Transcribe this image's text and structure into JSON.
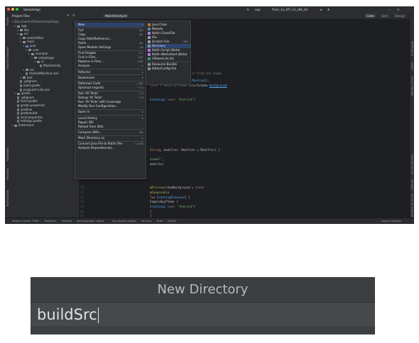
{
  "app": {
    "title": "SampleApp",
    "breadcrumb_project": "~/Documents/GitHub/SampleApp"
  },
  "toolbar": {
    "project_view_label": "Project Files",
    "run_config": "app",
    "device": "Pixel_3a_API_33_x86_64",
    "open_tab": "MainActivity.kt"
  },
  "editor_modes": {
    "code": "Code",
    "split": "Split",
    "design": "Design"
  },
  "left_tools": [
    "Project",
    "Resource Manager",
    "Bookmarks",
    "Structure",
    "Build Variants"
  ],
  "right_tools": [
    "Notifications",
    "Gradle",
    "Device Manager",
    "Running Devices",
    "Emulator",
    "Device File Explorer"
  ],
  "tree": [
    {
      "label": "app",
      "depth": 1,
      "kind": "folder"
    },
    {
      "label": "libs",
      "depth": 2,
      "kind": "folder"
    },
    {
      "label": "src",
      "depth": 2,
      "kind": "folder"
    },
    {
      "label": "androidTest",
      "depth": 3,
      "kind": "folder"
    },
    {
      "label": "main",
      "depth": 3,
      "kind": "folder"
    },
    {
      "label": "java",
      "depth": 4,
      "kind": "folder-blue"
    },
    {
      "label": "com",
      "depth": 5,
      "kind": "folder"
    },
    {
      "label": "example",
      "depth": 6,
      "kind": "folder"
    },
    {
      "label": "sampleapp",
      "depth": 7,
      "kind": "folder"
    },
    {
      "label": "ui",
      "depth": 8,
      "kind": "folder"
    },
    {
      "label": "MainActivity",
      "depth": 9,
      "kind": "file"
    },
    {
      "label": "res",
      "depth": 4,
      "kind": "folder"
    },
    {
      "label": "AndroidManifest.xml",
      "depth": 4,
      "kind": "file"
    },
    {
      "label": "test",
      "depth": 3,
      "kind": "folder"
    },
    {
      "label": ".gitignore",
      "depth": 2,
      "kind": "file"
    },
    {
      "label": "build.gradle",
      "depth": 2,
      "kind": "file"
    },
    {
      "label": "proguard-rules.pro",
      "depth": 2,
      "kind": "file"
    },
    {
      "label": "gradle",
      "depth": 1,
      "kind": "folder"
    },
    {
      "label": ".gitignore",
      "depth": 1,
      "kind": "file"
    },
    {
      "label": "build.gradle",
      "depth": 1,
      "kind": "file"
    },
    {
      "label": "gradle.properties",
      "depth": 1,
      "kind": "file"
    },
    {
      "label": "gradlew",
      "depth": 1,
      "kind": "file"
    },
    {
      "label": "gradlew.bat",
      "depth": 1,
      "kind": "file"
    },
    {
      "label": "local.properties",
      "depth": 1,
      "kind": "file"
    },
    {
      "label": "settings.gradle",
      "depth": 1,
      "kind": "file"
    },
    {
      "label": "Extensions",
      "depth": 0,
      "kind": "folder"
    }
  ],
  "context_menu": [
    {
      "label": "New",
      "shortcut": "",
      "submenu": true,
      "selected": true
    },
    {
      "sep": true
    },
    {
      "label": "Cut",
      "shortcut": "⌘X"
    },
    {
      "label": "Copy",
      "shortcut": "⌘C"
    },
    {
      "label": "Copy Path/Reference...",
      "shortcut": ""
    },
    {
      "label": "Paste",
      "shortcut": "⌘V"
    },
    {
      "label": "Open Module Settings",
      "shortcut": "↓⌘"
    },
    {
      "sep": true
    },
    {
      "label": "Find Usages",
      "shortcut": "⌥F7"
    },
    {
      "label": "Find in Files...",
      "shortcut": "⇧⌘F"
    },
    {
      "label": "Replace in Files...",
      "shortcut": "⇧⌘R"
    },
    {
      "label": "Analyze",
      "shortcut": "",
      "submenu": true
    },
    {
      "sep": true
    },
    {
      "label": "Refactor",
      "shortcut": "",
      "submenu": true
    },
    {
      "sep": true
    },
    {
      "label": "Bookmarks",
      "shortcut": "",
      "submenu": true
    },
    {
      "sep": true
    },
    {
      "label": "Reformat Code",
      "shortcut": "⌥⌘L"
    },
    {
      "label": "Optimize Imports",
      "shortcut": "^⌥O"
    },
    {
      "sep": true
    },
    {
      "label": "Run 'All Tests'",
      "shortcut": "^⇧R"
    },
    {
      "label": "Debug 'All Tests'",
      "shortcut": "^⇧D"
    },
    {
      "label": "Run 'All Tests' with Coverage",
      "shortcut": ""
    },
    {
      "label": "Modify Run Configuration...",
      "shortcut": ""
    },
    {
      "sep": true
    },
    {
      "label": "Open In",
      "shortcut": "",
      "submenu": true
    },
    {
      "sep": true
    },
    {
      "label": "Local History",
      "shortcut": "",
      "submenu": true
    },
    {
      "label": "Repair IDE",
      "shortcut": ""
    },
    {
      "label": "Reload from Disk",
      "shortcut": ""
    },
    {
      "sep": true
    },
    {
      "label": "Compare With...",
      "shortcut": "⌘D"
    },
    {
      "sep": true
    },
    {
      "label": "Mark Directory as",
      "shortcut": "",
      "submenu": true
    },
    {
      "sep": true
    },
    {
      "label": "Convert Java File to Kotlin File",
      "shortcut": "⌥⇧⌘K"
    },
    {
      "label": "Analyze Dependencies...",
      "shortcut": ""
    }
  ],
  "new_submenu": [
    {
      "label": "Java Class",
      "icon": "#c57825",
      "shortcut": ""
    },
    {
      "label": "Module",
      "icon": "#6f7ea7",
      "shortcut": ""
    },
    {
      "label": "Kotlin Class/File",
      "icon": "#b27be0",
      "shortcut": ""
    },
    {
      "label": "File",
      "icon": "#9aa0a8",
      "shortcut": ""
    },
    {
      "label": "Scratch File",
      "icon": "#9aa0a8",
      "shortcut": "⇧⌘N"
    },
    {
      "label": "Directory",
      "icon": "#8a8f98",
      "shortcut": "",
      "selected": true
    },
    {
      "label": "Kotlin Script (Beta)",
      "icon": "#b27be0",
      "shortcut": ""
    },
    {
      "label": "Kotlin Worksheet (Beta)",
      "icon": "#b27be0",
      "shortcut": ""
    },
    {
      "label": "CMakeLists.txt",
      "icon": "#3c9d6b",
      "shortcut": ""
    },
    {
      "sep": true
    },
    {
      "label": "Resource Bundle",
      "icon": "#8a8f98",
      "shortcut": ""
    },
    {
      "label": "EditorConfig File",
      "icon": "#8a8f98",
      "shortcut": ""
    }
  ],
  "code_lines": [
    {
      "parts": [
        [
          "",
          "te: Bundle?) {"
        ]
      ],
      "row": 15
    },
    {
      "parts": [
        [
          "cm",
          "ing the `background` color from the theme"
        ]
      ],
      "row": 21
    },
    {
      "parts": [
        [
          "",
          "modifier = Modifier."
        ],
        [
          "fn",
          "fillMaxSize"
        ],
        [
          "",
          "(),"
        ]
      ],
      "row": 24
    },
    {
      "parts": [
        [
          "",
          "color = MaterialTheme.colorScheme."
        ],
        [
          "pm",
          "background"
        ]
      ],
      "row": 26
    },
    {
      "parts": [
        [
          "fn",
          "Greeting"
        ],
        [
          "",
          "( "
        ],
        [
          "cm",
          "name: "
        ],
        [
          "st",
          "\"Android\""
        ],
        [
          "",
          ")"
        ]
      ],
      "row": 32
    },
    {
      "parts": [
        [
          "kw",
          "String"
        ],
        [
          "",
          ", modifier: Modifier = Modifier) {"
        ]
      ],
      "row": 53
    },
    {
      "parts": [
        [
          "",
          "  "
        ],
        [
          "st",
          "$name"
        ],
        [
          "",
          "!\","
        ]
      ],
      "row": 57
    },
    {
      "parts": [
        [
          "",
          "modifier"
        ]
      ],
      "row": 59
    },
    {
      "parts": [
        [
          "an",
          "@Preview"
        ],
        [
          "",
          "(showBackground = "
        ],
        [
          "kw",
          "true"
        ],
        [
          "",
          ")"
        ]
      ],
      "row": 69
    },
    {
      "parts": [
        [
          "an",
          "@Composable"
        ]
      ],
      "row": 71
    },
    {
      "parts": [
        [
          "kw",
          "fun "
        ],
        [
          "fn",
          "GreetingPreview"
        ],
        [
          "",
          "() {"
        ]
      ],
      "row": 73
    },
    {
      "parts": [
        [
          "",
          "    SampleAppTheme {"
        ]
      ],
      "row": 75
    },
    {
      "parts": [
        [
          "",
          "        "
        ],
        [
          "fn",
          "Greeting"
        ],
        [
          "",
          "( "
        ],
        [
          "cm",
          "name: "
        ],
        [
          "st",
          "\"Android\""
        ],
        [
          "",
          ")"
        ]
      ],
      "row": 77
    },
    {
      "parts": [
        [
          "",
          "    }"
        ]
      ],
      "row": 79
    },
    {
      "parts": [
        [
          "",
          "}"
        ]
      ],
      "row": 81
    }
  ],
  "status_tabs": [
    "Version Control",
    "TODO",
    "Problems",
    "Terminal",
    "App Inspection",
    "Logcat",
    "App Quality Insights",
    "Services",
    "Build",
    "Profiler"
  ],
  "status_right": "Layout Inspector",
  "dialog": {
    "title": "New Directory",
    "value": "buildSrc"
  }
}
